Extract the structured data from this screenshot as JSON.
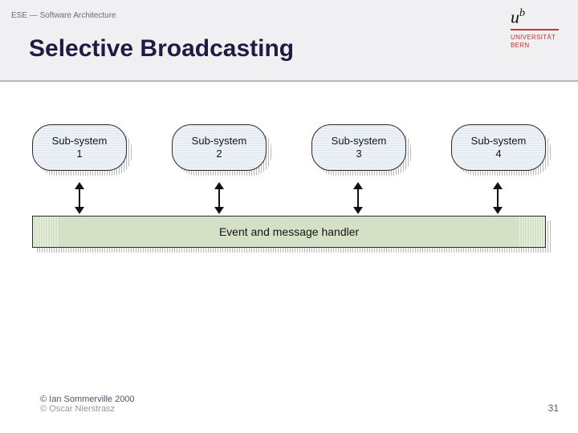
{
  "header": {
    "breadcrumb": "ESE — Software Architecture",
    "title": "Selective Broadcasting"
  },
  "logo": {
    "mark": "u",
    "mark_sup": "b",
    "line1": "UNIVERSITÄT",
    "line2": "BERN"
  },
  "diagram": {
    "subsystems": [
      {
        "l1": "Sub-system",
        "l2": "1"
      },
      {
        "l1": "Sub-system",
        "l2": "2"
      },
      {
        "l1": "Sub-system",
        "l2": "3"
      },
      {
        "l1": "Sub-system",
        "l2": "4"
      }
    ],
    "handler_label": "Event and message handler"
  },
  "footer": {
    "credit_main": "© Ian Sommerville 2000",
    "credit_bg": "© Oscar Nierstrasz",
    "page": "31"
  }
}
